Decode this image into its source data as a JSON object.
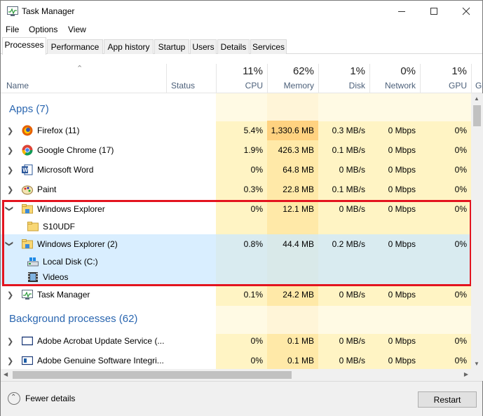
{
  "window": {
    "title": "Task Manager"
  },
  "menu": {
    "file": "File",
    "options": "Options",
    "view": "View"
  },
  "tabs": [
    "Processes",
    "Performance",
    "App history",
    "Startup",
    "Users",
    "Details",
    "Services"
  ],
  "header": {
    "name": "Name",
    "status": "Status",
    "cpu": {
      "pct": "11%",
      "label": "CPU"
    },
    "memory": {
      "pct": "62%",
      "label": "Memory"
    },
    "disk": {
      "pct": "1%",
      "label": "Disk"
    },
    "network": {
      "pct": "0%",
      "label": "Network"
    },
    "gpu": {
      "pct": "1%",
      "label": "GPU"
    },
    "gpu_engine": "GI"
  },
  "groups": {
    "apps": "Apps (7)",
    "background": "Background processes (62)"
  },
  "apps": [
    {
      "name": "Firefox (11)",
      "icon": "firefox-icon",
      "cpu": "5.4%",
      "memory": "1,330.6 MB",
      "disk": "0.3 MB/s",
      "network": "0 Mbps",
      "gpu": "0%"
    },
    {
      "name": "Google Chrome (17)",
      "icon": "chrome-icon",
      "cpu": "1.9%",
      "memory": "426.3 MB",
      "disk": "0.1 MB/s",
      "network": "0 Mbps",
      "gpu": "0%"
    },
    {
      "name": "Microsoft Word",
      "icon": "word-icon",
      "cpu": "0%",
      "memory": "64.8 MB",
      "disk": "0 MB/s",
      "network": "0 Mbps",
      "gpu": "0%"
    },
    {
      "name": "Paint",
      "icon": "paint-icon",
      "cpu": "0.3%",
      "memory": "22.8 MB",
      "disk": "0.1 MB/s",
      "network": "0 Mbps",
      "gpu": "0%"
    },
    {
      "name": "Windows Explorer",
      "icon": "explorer-icon",
      "cpu": "0%",
      "memory": "12.1 MB",
      "disk": "0 MB/s",
      "network": "0 Mbps",
      "gpu": "0%"
    },
    {
      "name": "Windows Explorer (2)",
      "icon": "explorer-icon",
      "cpu": "0.8%",
      "memory": "44.4 MB",
      "disk": "0.2 MB/s",
      "network": "0 Mbps",
      "gpu": "0%"
    },
    {
      "name": "Task Manager",
      "icon": "task-manager-icon",
      "cpu": "0.1%",
      "memory": "24.2 MB",
      "disk": "0 MB/s",
      "network": "0 Mbps",
      "gpu": "0%"
    }
  ],
  "subitems": {
    "explorer1": "S10UDF",
    "explorer2_a": "Local Disk (C:)",
    "explorer2_b": "Videos"
  },
  "background": [
    {
      "name": "Adobe Acrobat Update Service (...",
      "icon": "acrobat-icon",
      "cpu": "0%",
      "memory": "0.1 MB",
      "disk": "0 MB/s",
      "network": "0 Mbps",
      "gpu": "0%"
    },
    {
      "name": "Adobe Genuine Software Integri...",
      "icon": "adobe-genuine-icon",
      "cpu": "0%",
      "memory": "0.1 MB",
      "disk": "0 MB/s",
      "network": "0 Mbps",
      "gpu": "0%"
    }
  ],
  "footer": {
    "fewer_details": "Fewer details",
    "restart": "Restart"
  },
  "colors": {
    "heat_light": "#fff4c4",
    "heat_mid": "#ffe9a8",
    "heat_high": "#ffd280",
    "selection": "#cce8ff",
    "highlight_box": "#e3141f",
    "group_text": "#2a66b0"
  }
}
